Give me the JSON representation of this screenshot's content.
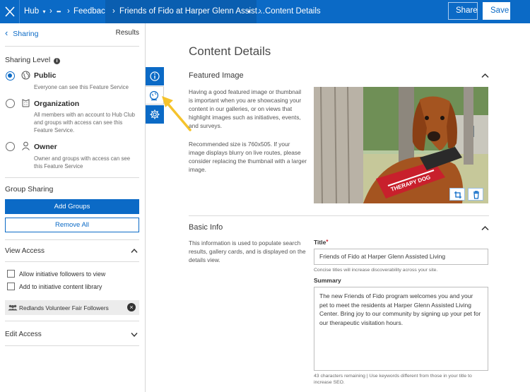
{
  "topbar": {
    "hub_label": "Hub",
    "ellipsis": "•••",
    "feedback": "Feedback",
    "current": "Friends of Fido at Harper Glenn Assist…",
    "content_details": "Content Details",
    "share_label": "Share",
    "save_label": "Save"
  },
  "left_panel": {
    "back_label": "Sharing",
    "results_label": "Results",
    "sharing_level_label": "Sharing Level",
    "options": [
      {
        "title": "Public",
        "desc": "Everyone can see this Feature Service",
        "icon": "globe-icon",
        "selected": true
      },
      {
        "title": "Organization",
        "desc": "All members with an account to Hub Club and groups with access can see this Feature Service.",
        "icon": "building-icon",
        "selected": false
      },
      {
        "title": "Owner",
        "desc": "Owner and groups with access can see this Feature Service",
        "icon": "person-icon",
        "selected": false
      }
    ],
    "group_sharing_label": "Group Sharing",
    "add_groups_label": "Add Groups",
    "remove_all_label": "Remove All",
    "view_access_label": "View Access",
    "allow_followers_label": "Allow initiative followers to view",
    "add_library_label": "Add to initiative content library",
    "chip_label": "Redlands Volunteer Fair Followers",
    "edit_access_label": "Edit Access"
  },
  "main": {
    "page_title": "Content Details",
    "featured_image_label": "Featured Image",
    "featured_desc": "Having a good featured image or thumbnail is important when you are showcasing your content in our galleries, or on views that highlight images such as initiatives, events, and surveys.",
    "featured_recommend": "Recommended size is 760x505. If your image displays blurry on live routes, please consider replacing the thumbnail with a larger image.",
    "dog_harness_text": "THERAPY DOG",
    "basic_info_label": "Basic Info",
    "basic_info_desc": "This information is used to populate search results, gallery cards, and is displayed on the details view.",
    "title_label": "Title",
    "title_value": "Friends of Fido at Harper Glenn Assisted Living",
    "title_hint": "Concise titles will increase discoverability across your site.",
    "summary_label": "Summary",
    "summary_value": "The new Friends of Fido program welcomes you and your pet to meet the residents at Harper Glenn Assisted Living Center. Bring joy to our community by signing up your pet for our therapeutic visitation hours.",
    "summary_hint": "43 characters remaining | Use keywords different from those in your title to increase SEO."
  },
  "colors": {
    "brand_blue": "#0b6ac6",
    "arrow_yellow": "#f5c32c"
  }
}
